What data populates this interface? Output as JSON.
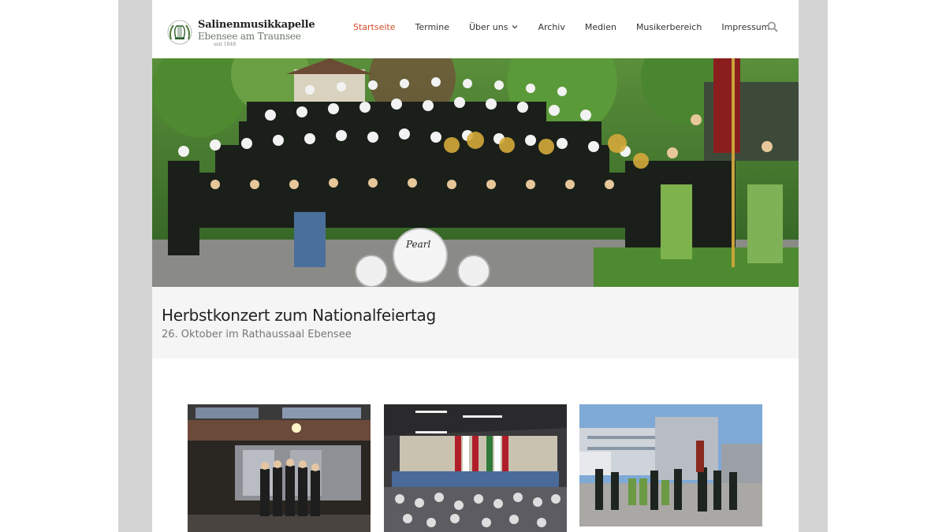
{
  "logo": {
    "name": "Salinenmusikkapelle",
    "subtitle": "Ebensee am Traunsee",
    "since": "seit 1848"
  },
  "nav": {
    "items": [
      {
        "label": "Startseite",
        "active": true
      },
      {
        "label": "Termine"
      },
      {
        "label": "Über uns",
        "dropdown": true
      },
      {
        "label": "Archiv"
      },
      {
        "label": "Medien"
      },
      {
        "label": "Musikerbereich"
      },
      {
        "label": "Impressum"
      }
    ],
    "active_color": "#d2502a",
    "search_icon": "search-icon"
  },
  "hero": {
    "drum_brand": "Pearl"
  },
  "slide": {
    "title": "Herbstkonzert zum Nationalfeiertag",
    "subtitle": "26. Oktober im Rathaussaal Ebensee"
  },
  "colors": {
    "side_frame": "#d4d4d4",
    "caption_bg": "#f5f5f5"
  }
}
